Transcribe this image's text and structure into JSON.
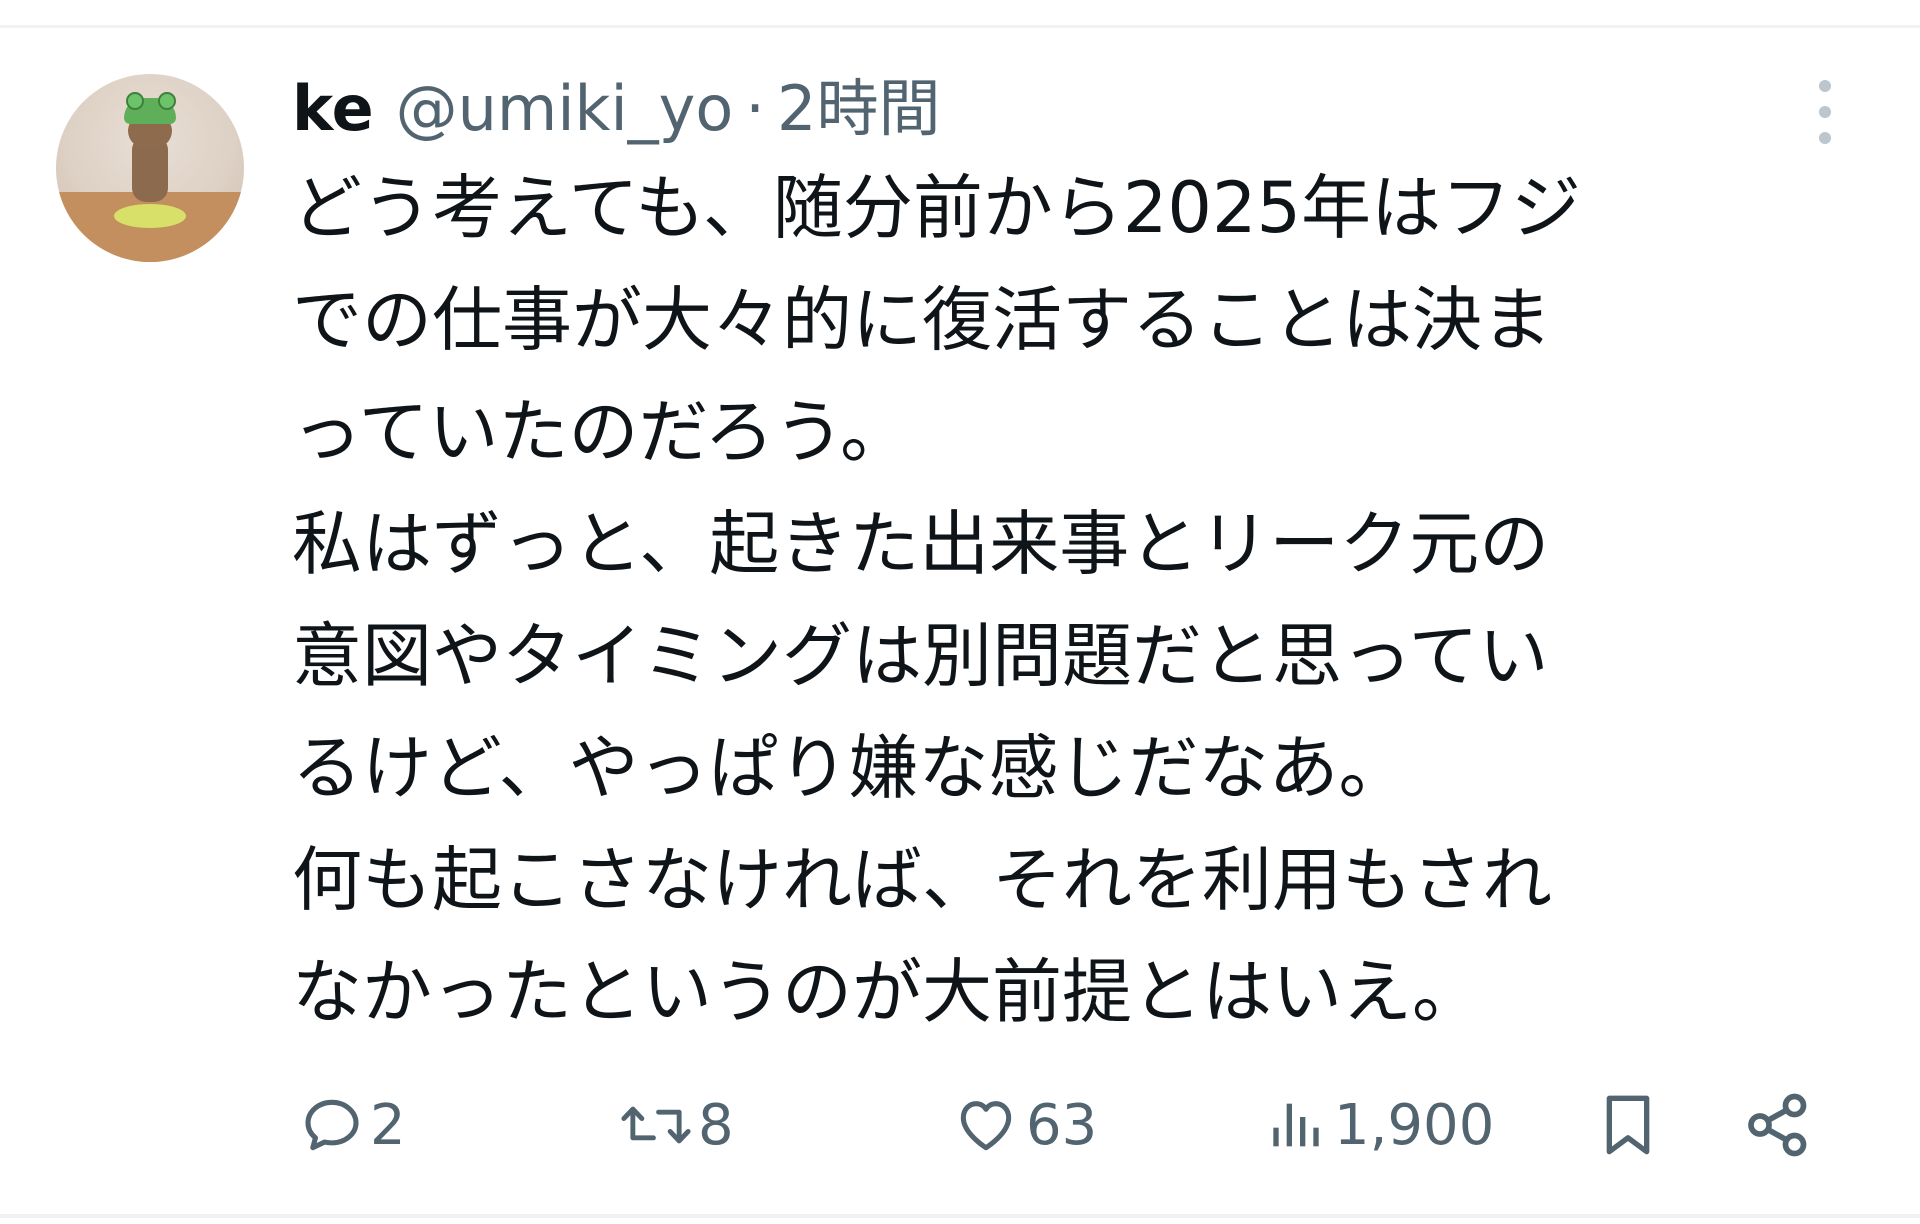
{
  "tweet": {
    "author": {
      "display_name": "ke",
      "handle": "@umiki_yo",
      "separator": "·",
      "time": "2時間"
    },
    "lines": [
      "どう考えても、随分前から2025年はフジ",
      "での仕事が大々的に復活することは決ま",
      "っていたのだろう。",
      "私はずっと、起きた出来事とリーク元の",
      "意図やタイミングは別問題だと思ってい",
      "るけど、やっぱり嫌な感じだなあ。",
      "何も起こさなければ、それを利用もされ",
      "なかったというのが大前提とはいえ。"
    ],
    "actions": {
      "reply_count": "2",
      "retweet_count": "8",
      "like_count": "63",
      "view_count": "1,900"
    },
    "icons": {
      "reply": "reply-icon",
      "retweet": "retweet-icon",
      "like": "heart-icon",
      "views": "views-icon",
      "bookmark": "bookmark-icon",
      "share": "share-icon",
      "more": "more-icon"
    },
    "colors": {
      "text": "#0f1419",
      "secondary": "#536471",
      "divider": "#eff3f4"
    }
  }
}
